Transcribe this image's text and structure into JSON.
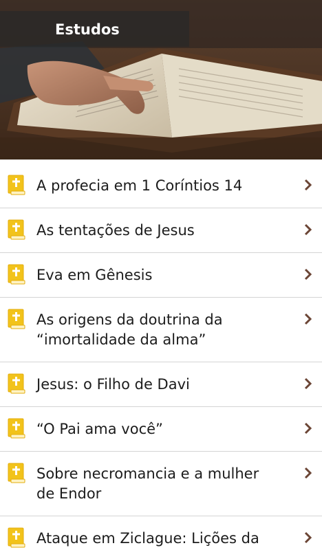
{
  "header": {
    "title": "Estudos"
  },
  "colors": {
    "title_bar": "#2a2a2a",
    "icon_gold": "#f2c31b",
    "chevron": "#6b4535",
    "divider": "#d4d4d4"
  },
  "studies": [
    {
      "label": "A profecia em 1 Coríntios 14",
      "icon": "bible-book-icon"
    },
    {
      "label": "As tentações de Jesus",
      "icon": "bible-book-icon"
    },
    {
      "label": "Eva em Gênesis",
      "icon": "bible-book-icon"
    },
    {
      "label": "As origens da doutrina da “imortalidade da alma”",
      "icon": "bible-book-icon"
    },
    {
      "label": "Jesus: o Filho de Davi",
      "icon": "bible-book-icon"
    },
    {
      "label": "“O Pai ama você”",
      "icon": "bible-book-icon"
    },
    {
      "label": "Sobre necromancia e a mulher de Endor",
      "icon": "bible-book-icon"
    },
    {
      "label": "Ataque em Ziclague: Lições da",
      "icon": "bible-book-icon"
    }
  ]
}
